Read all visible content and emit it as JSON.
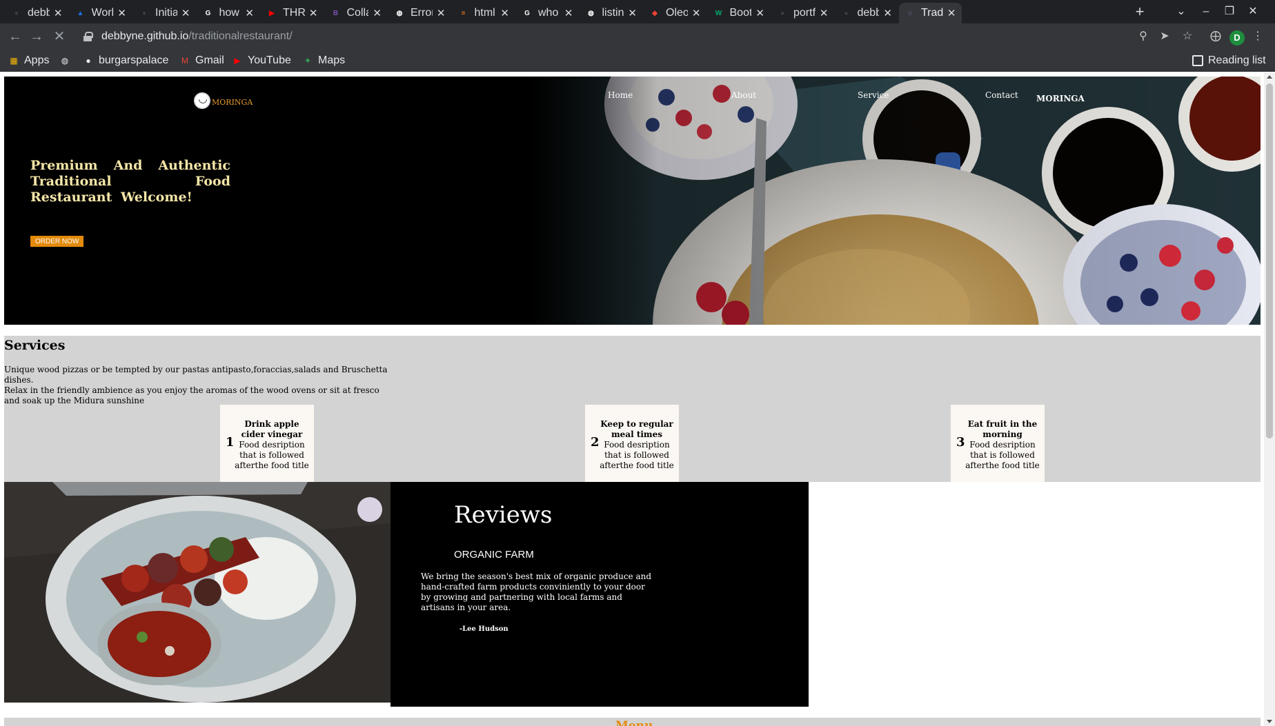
{
  "browser": {
    "tabs": [
      {
        "label": "debby",
        "icon": "github-icon",
        "color": "#3c4043"
      },
      {
        "label": "Work |",
        "icon": "drive-icon",
        "color": "#1a73e8"
      },
      {
        "label": "Initial",
        "icon": "github-icon",
        "color": "#3c4043"
      },
      {
        "label": "how tc",
        "icon": "google-icon",
        "color": "#ffffff"
      },
      {
        "label": "THRO\\",
        "icon": "youtube-icon",
        "color": "#ff0000"
      },
      {
        "label": "Collap",
        "icon": "bootstrap-icon",
        "color": "#7952b3"
      },
      {
        "label": "Error",
        "icon": "globe-icon",
        "color": "#ffffff"
      },
      {
        "label": "html -",
        "icon": "stackoverflow-icon",
        "color": "#f48024"
      },
      {
        "label": "who is",
        "icon": "google-icon",
        "color": "#ffffff"
      },
      {
        "label": "listing",
        "icon": "globe-icon",
        "color": "#ffffff"
      },
      {
        "label": "Oleo S",
        "icon": "oleo-icon",
        "color": "#e94235"
      },
      {
        "label": "Boots",
        "icon": "w3schools-icon",
        "color": "#04aa6d"
      },
      {
        "label": "portfo",
        "icon": "github-icon",
        "color": "#3c4043"
      },
      {
        "label": "debby",
        "icon": "github-icon",
        "color": "#3c4043"
      },
      {
        "label": "Tradit",
        "icon": "loading-icon",
        "color": "#8ab4f8",
        "active": true
      }
    ],
    "url_host": "debbyne.github.io",
    "url_path": "/traditionalrestaurant/",
    "profile_initial": "D",
    "bookmarks": [
      {
        "label": "Apps",
        "icon": "apps-grid-icon"
      },
      {
        "label": "",
        "icon": "globe-icon"
      },
      {
        "label": "burgarspalace",
        "icon": "github-icon"
      },
      {
        "label": "Gmail",
        "icon": "gmail-icon"
      },
      {
        "label": "YouTube",
        "icon": "youtube-icon"
      },
      {
        "label": "Maps",
        "icon": "maps-icon"
      }
    ],
    "reading_list": "Reading list"
  },
  "site": {
    "logo_text": "MORINGA",
    "nav": [
      "Home",
      "About",
      "Service",
      "Contact"
    ],
    "nav_brand": "MORINGA",
    "hero_title": "Premium And Authentic Traditional Food Restaurant Welcome!",
    "order_button": "ORDER NOW",
    "services": {
      "heading": "Services",
      "text_line1": "Unique wood pizzas or be tempted by our pastas antipasto,foraccias,salads and Bruschetta dishes.",
      "text_line2": "Relax in the friendly ambience as you enjoy the aromas of the wood ovens or sit at fresco and soak up the Midura sunshine",
      "cards": [
        {
          "num": "1",
          "title": "Drink apple cider vinegar",
          "desc": "Food desription that is followed afterthe food title"
        },
        {
          "num": "2",
          "title": "Keep to regular meal times",
          "desc": "Food desription that is followed afterthe food title"
        },
        {
          "num": "3",
          "title": "Eat fruit in the morning",
          "desc": "Food desription that is followed afterthe food title"
        }
      ]
    },
    "reviews": {
      "heading": "Reviews",
      "subheading": "ORGANIC FARM",
      "text": "We bring the season's best mix of organic produce and hand-crafted farm products conviniently to your door by growing and partnering with local farms and artisans in your area.",
      "author": "-Lee Hudson"
    },
    "menu_heading": "Menu"
  },
  "colors": {
    "accent": "#e38a0c",
    "hero_title": "#f5e6a8",
    "section_bg": "#d3d3d3"
  }
}
